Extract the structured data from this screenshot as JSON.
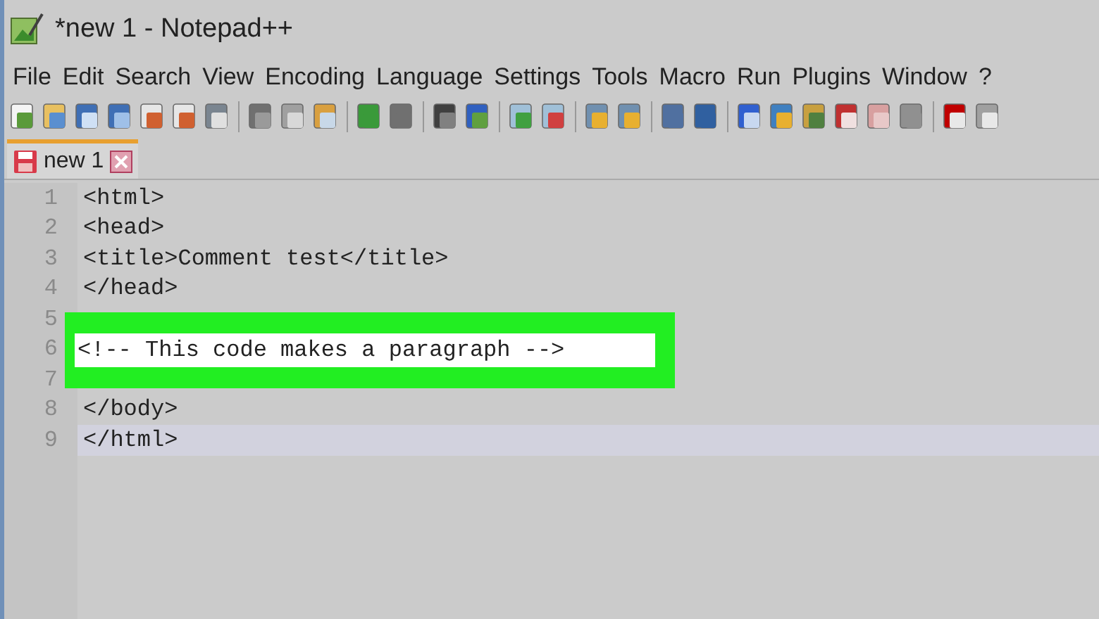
{
  "window": {
    "title": "*new 1 - Notepad++"
  },
  "menu": [
    "File",
    "Edit",
    "Search",
    "View",
    "Encoding",
    "Language",
    "Settings",
    "Tools",
    "Macro",
    "Run",
    "Plugins",
    "Window",
    "?"
  ],
  "tabs": [
    {
      "label": "new 1",
      "selected": true,
      "modified": true
    }
  ],
  "editor": {
    "lines": [
      {
        "number": "1",
        "text": "<html>",
        "current": false,
        "highlighted": false
      },
      {
        "number": "2",
        "text": "<head>",
        "current": false,
        "highlighted": false
      },
      {
        "number": "3",
        "text": "<title>Comment test</title>",
        "current": false,
        "highlighted": false
      },
      {
        "number": "4",
        "text": "</head>",
        "current": false,
        "highlighted": false
      },
      {
        "number": "5",
        "current": false,
        "highlighted": false
      },
      {
        "number": "6",
        "text": "<!-- This code makes a paragraph -->",
        "current": false,
        "highlighted": true
      },
      {
        "number": "7",
        "current": false,
        "highlighted": false
      },
      {
        "number": "8",
        "text": "</body>",
        "current": false,
        "highlighted": false
      },
      {
        "number": "9",
        "text": "</html>",
        "current": true,
        "highlighted": false
      }
    ]
  }
}
